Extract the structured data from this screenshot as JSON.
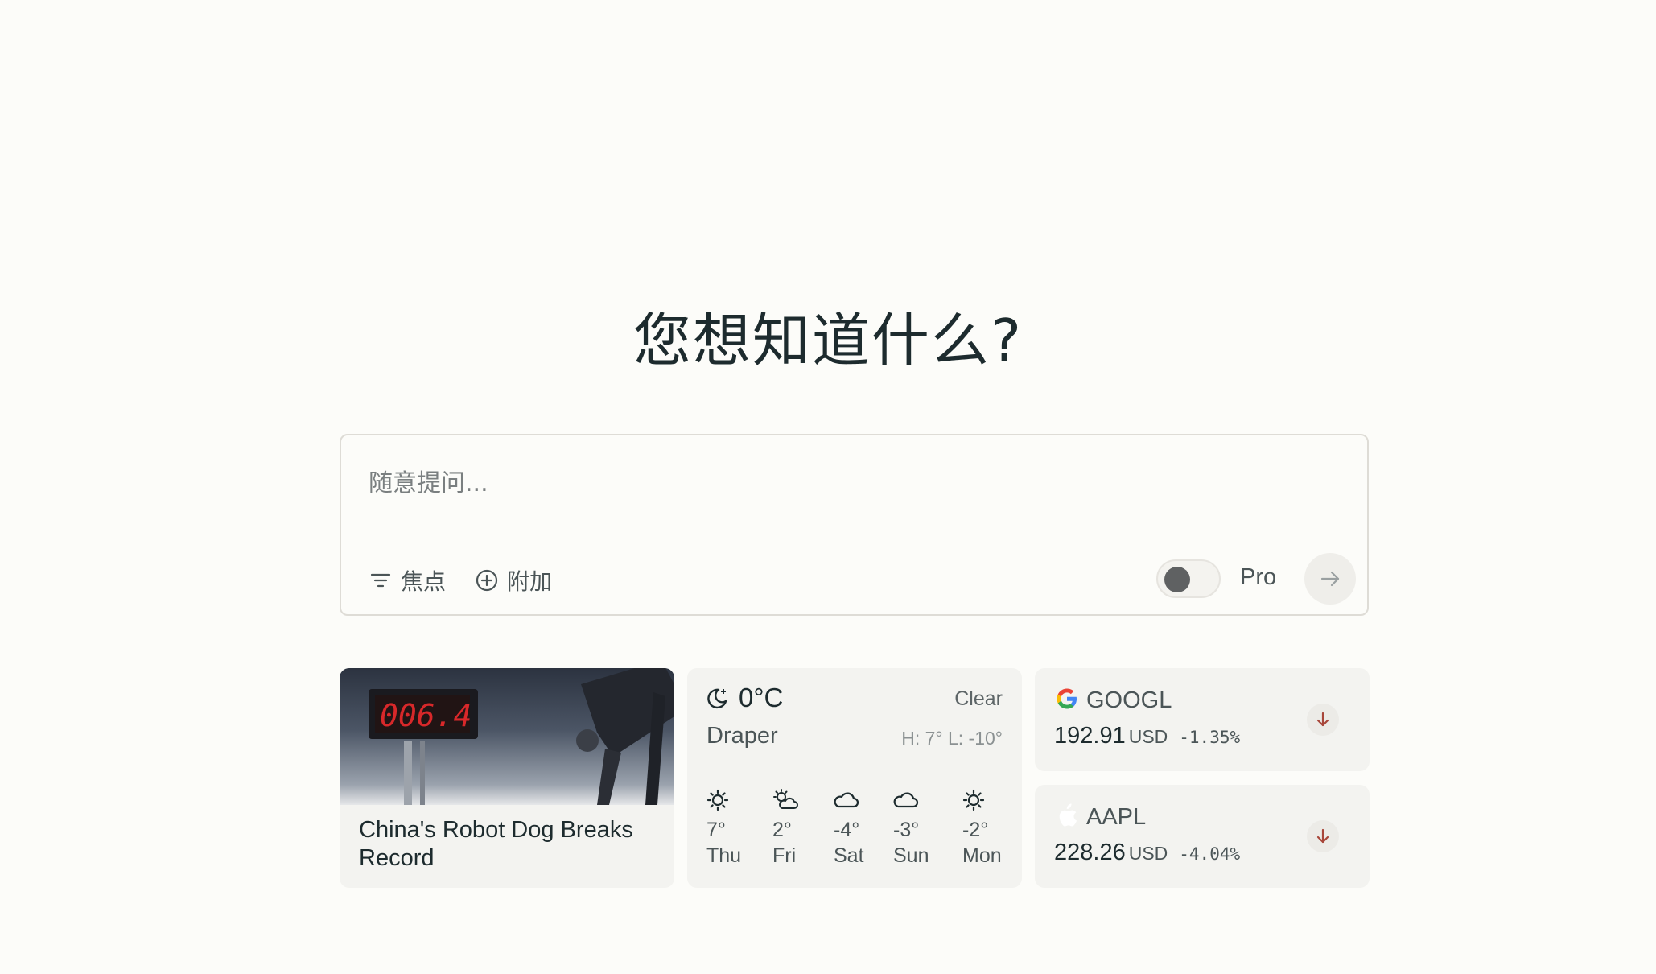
{
  "headline": "您想知道什么?",
  "search": {
    "placeholder": "随意提问...",
    "focus_label": "焦点",
    "attach_label": "附加",
    "pro_label": "Pro",
    "pro_enabled": false
  },
  "news": {
    "title": "China's Robot Dog Breaks Record"
  },
  "weather": {
    "now_icon": "moon-clear-icon",
    "temperature": "0°C",
    "condition": "Clear",
    "city": "Draper",
    "hi_lo": "H: 7° L: -10°",
    "forecast": [
      {
        "icon": "sun-icon",
        "temp": "7°",
        "day": "Thu"
      },
      {
        "icon": "partly-cloudy-icon",
        "temp": "2°",
        "day": "Fri"
      },
      {
        "icon": "cloud-icon",
        "temp": "-4°",
        "day": "Sat"
      },
      {
        "icon": "cloud-icon",
        "temp": "-3°",
        "day": "Sun"
      },
      {
        "icon": "sun-icon",
        "temp": "-2°",
        "day": "Mon"
      }
    ]
  },
  "stocks": [
    {
      "logo": "google-logo-icon",
      "ticker": "GOOGL",
      "price": "192.91",
      "currency": "USD",
      "change": "-1.35%",
      "trend": "down",
      "trend_color": "#a8463a"
    },
    {
      "logo": "apple-logo-icon",
      "ticker": "AAPL",
      "price": "228.26",
      "currency": "USD",
      "change": "-4.04%",
      "trend": "down",
      "trend_color": "#a8463a"
    }
  ],
  "colors": {
    "background": "#fcfcf9",
    "card": "#f3f3f0",
    "text": "#13343b",
    "down": "#a8463a"
  }
}
